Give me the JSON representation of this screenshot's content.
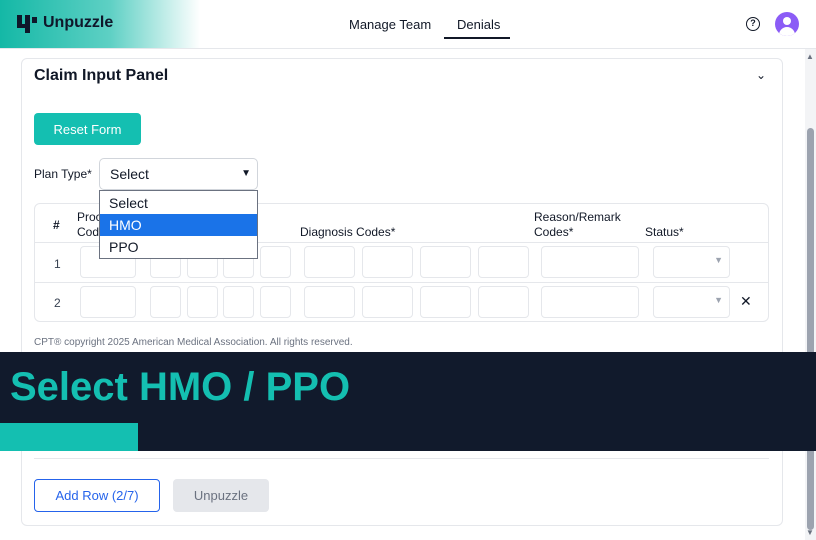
{
  "header": {
    "brand": "Unpuzzle",
    "nav": [
      "Manage Team",
      "Denials"
    ],
    "active_tab": "Denials",
    "help_icon": "question-circle-icon"
  },
  "panel": {
    "title": "Claim Input Panel",
    "reset_label": "Reset Form",
    "plan_type_label": "Plan Type*",
    "plan_select_value": "Select",
    "plan_options": [
      "Select",
      "HMO",
      "PPO"
    ],
    "highlighted_option": "HMO",
    "table": {
      "headers": {
        "num": "#",
        "procedure_partial_1": "Proc",
        "procedure_partial_2": "Cod",
        "diagnosis": "Diagnosis Codes*",
        "reason_1": "Reason/Remark",
        "reason_2": "Codes*",
        "status": "Status*"
      },
      "rows": [
        "1",
        "2"
      ]
    },
    "copyright": "CPT® copyright 2025 American Medical Association. All rights reserved.",
    "add_row_label": "Add Row (2/7)",
    "unpuzzle_label": "Unpuzzle"
  },
  "banner": {
    "text": "Select HMO / PPO"
  },
  "colors": {
    "accent": "#14bfb1",
    "banner_bg": "#111a2c",
    "selected_option": "#1a73e8",
    "link_blue": "#2563eb"
  }
}
